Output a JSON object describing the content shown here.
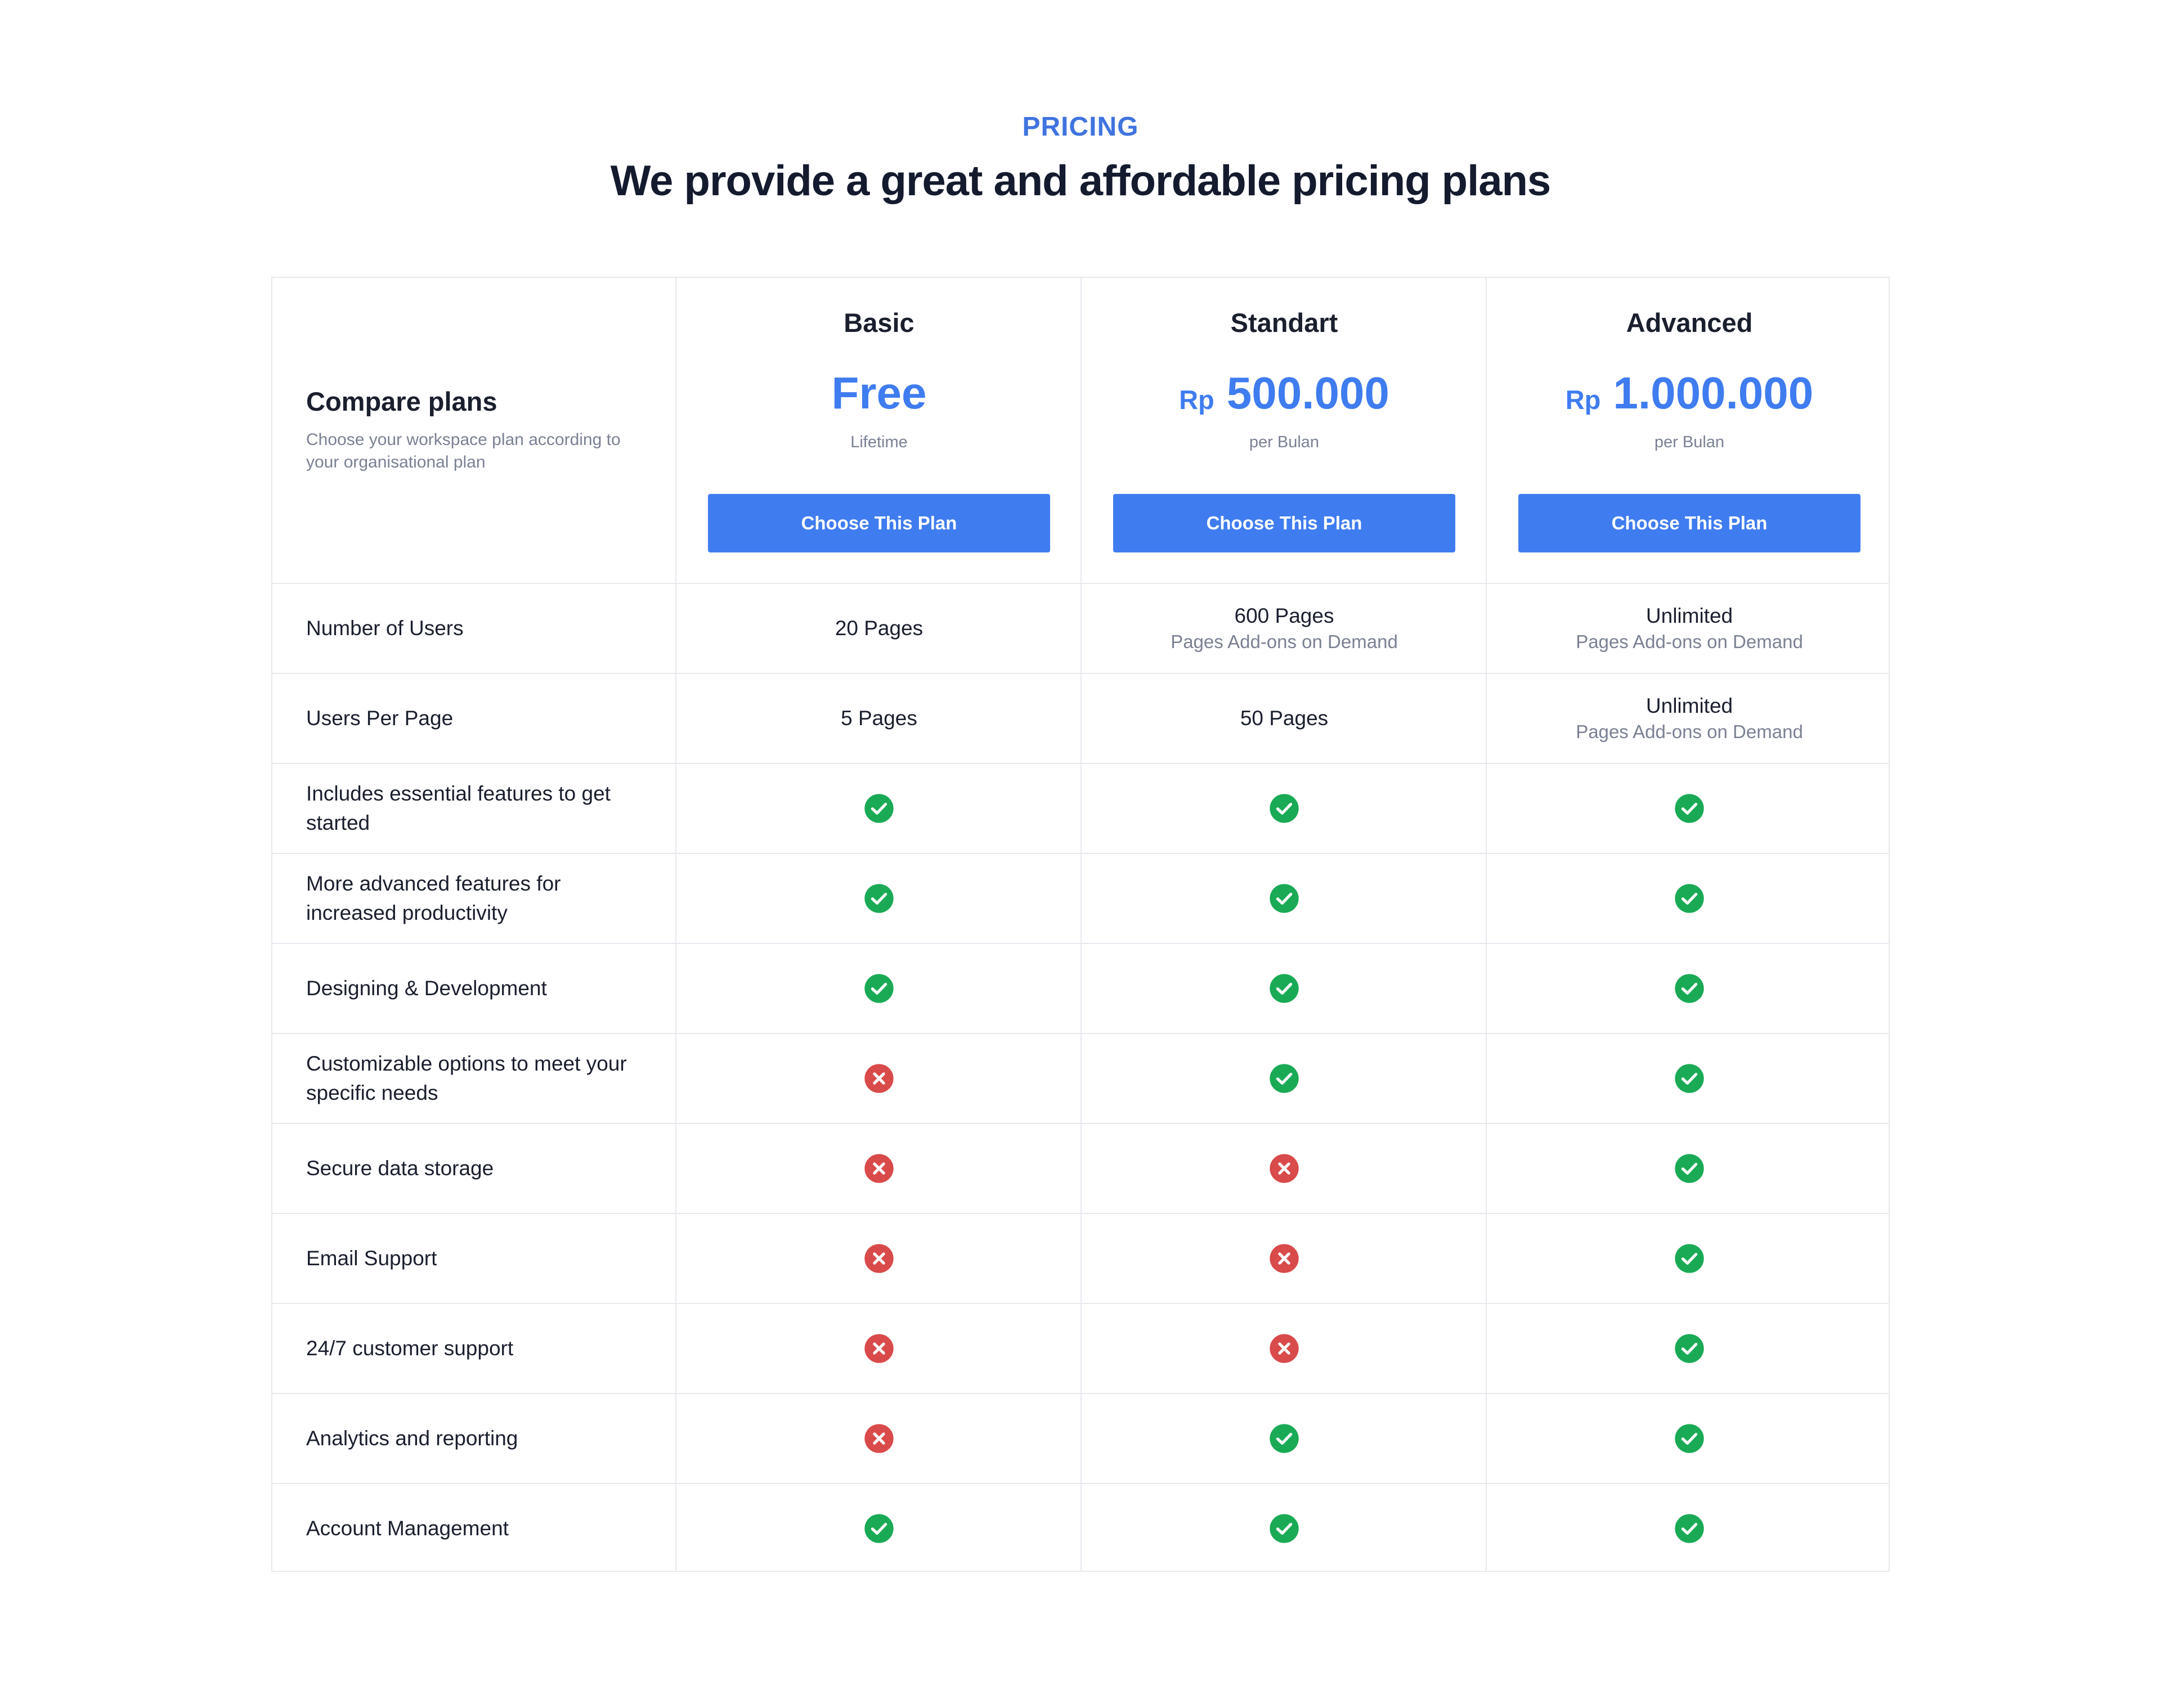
{
  "section": {
    "eyebrow": "PRICING",
    "headline": "We provide a great and affordable pricing plans"
  },
  "compare": {
    "title": "Compare plans",
    "subtitle": "Choose your workspace plan according to your organisational plan"
  },
  "plans": [
    {
      "name": "Basic",
      "price_prefix": "",
      "price": "Free",
      "period": "Lifetime",
      "button": "Choose This Plan"
    },
    {
      "name": "Standart",
      "price_prefix": "Rp",
      "price": "500.000",
      "period": "per Bulan",
      "button": "Choose This Plan"
    },
    {
      "name": "Advanced",
      "price_prefix": "Rp",
      "price": "1.000.000",
      "period": "per Bulan",
      "button": "Choose This Plan"
    }
  ],
  "value_rows": [
    {
      "label": "Number of Users",
      "values": [
        {
          "main": "20 Pages",
          "sub": ""
        },
        {
          "main": "600 Pages",
          "sub": "Pages Add-ons on Demand"
        },
        {
          "main": "Unlimited",
          "sub": "Pages Add-ons on Demand"
        }
      ]
    },
    {
      "label": "Users Per Page",
      "values": [
        {
          "main": "5 Pages",
          "sub": ""
        },
        {
          "main": "50 Pages",
          "sub": ""
        },
        {
          "main": "Unlimited",
          "sub": "Pages Add-ons on Demand"
        }
      ]
    }
  ],
  "feature_rows": [
    {
      "label": "Includes essential features to get started",
      "included": [
        true,
        true,
        true
      ]
    },
    {
      "label": "More advanced features for increased productivity",
      "included": [
        true,
        true,
        true
      ]
    },
    {
      "label": "Designing & Development",
      "included": [
        true,
        true,
        true
      ]
    },
    {
      "label": "Customizable options to meet your specific needs",
      "included": [
        false,
        true,
        true
      ]
    },
    {
      "label": "Secure data storage",
      "included": [
        false,
        false,
        true
      ]
    },
    {
      "label": "Email Support",
      "included": [
        false,
        false,
        true
      ]
    },
    {
      "label": "24/7 customer support",
      "included": [
        false,
        false,
        true
      ]
    },
    {
      "label": "Analytics and reporting",
      "included": [
        false,
        true,
        true
      ]
    },
    {
      "label": "Account Management",
      "included": [
        true,
        true,
        true
      ]
    }
  ],
  "icons": {
    "included": "check-circle-icon",
    "excluded": "x-circle-icon"
  },
  "colors": {
    "accent": "#3f7cf0",
    "eyebrow": "#3f73e0",
    "check": "#1aaa55",
    "cross": "#d94a4a",
    "border": "#e7e9ee"
  }
}
